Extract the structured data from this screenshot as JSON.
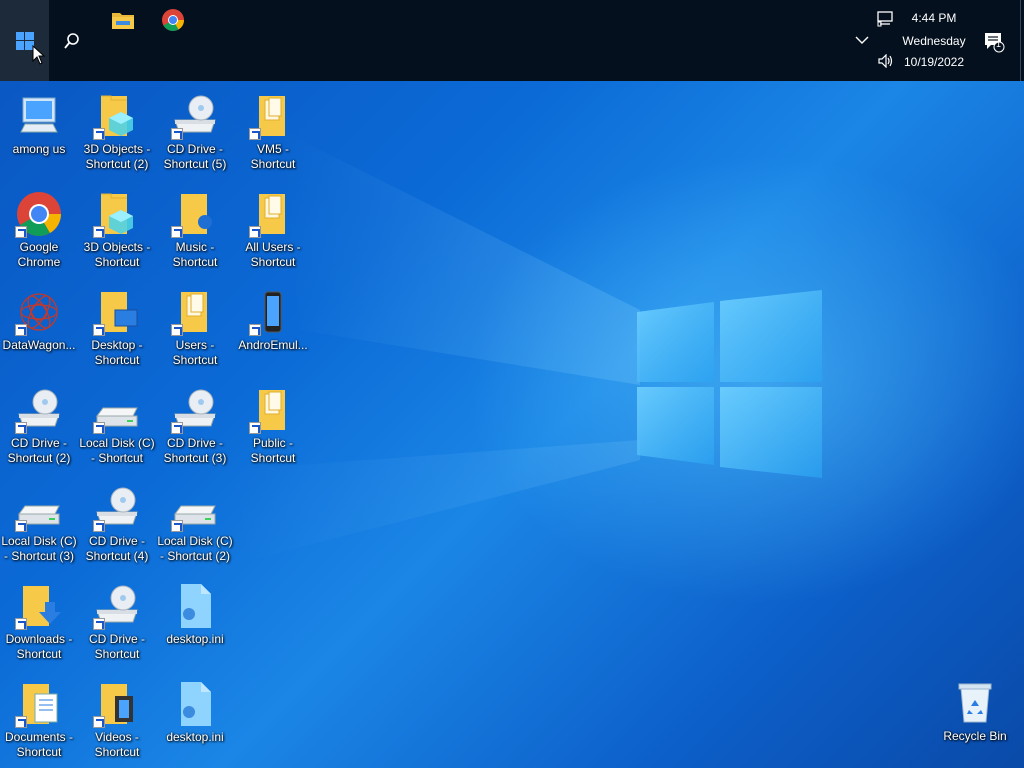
{
  "taskbar": {
    "pinned": [
      {
        "name": "file-explorer-icon"
      },
      {
        "name": "chrome-icon"
      }
    ],
    "clock": {
      "time": "4:44 PM",
      "day": "Wednesday",
      "date": "10/19/2022"
    },
    "notification_count": "1"
  },
  "desktop_icons": [
    {
      "label": "among us",
      "type": "computer",
      "shortcut": false
    },
    {
      "label": "3D Objects - Shortcut (2)",
      "type": "folder-3d",
      "shortcut": true
    },
    {
      "label": "CD Drive - Shortcut (5)",
      "type": "cd-drive",
      "shortcut": true
    },
    {
      "label": "VM5 - Shortcut",
      "type": "folder-docs",
      "shortcut": true
    },
    {
      "label": "Google Chrome",
      "type": "chrome",
      "shortcut": true
    },
    {
      "label": "3D Objects - Shortcut",
      "type": "folder-3d",
      "shortcut": true
    },
    {
      "label": "Music - Shortcut",
      "type": "folder-music",
      "shortcut": true
    },
    {
      "label": "All Users - Shortcut",
      "type": "folder-docs",
      "shortcut": true
    },
    {
      "label": "DataWagon...",
      "type": "datawagon",
      "shortcut": true
    },
    {
      "label": "Desktop - Shortcut",
      "type": "folder-desktop",
      "shortcut": true
    },
    {
      "label": "Users - Shortcut",
      "type": "folder-docs",
      "shortcut": true
    },
    {
      "label": "AndroEmul...",
      "type": "phone",
      "shortcut": true
    },
    {
      "label": "CD Drive - Shortcut (2)",
      "type": "cd-drive",
      "shortcut": true
    },
    {
      "label": "Local Disk (C) - Shortcut",
      "type": "local-disk",
      "shortcut": true
    },
    {
      "label": "CD Drive - Shortcut (3)",
      "type": "cd-drive",
      "shortcut": true
    },
    {
      "label": "Public - Shortcut",
      "type": "folder-docs",
      "shortcut": true
    },
    {
      "label": "Local Disk (C) - Shortcut (3)",
      "type": "local-disk",
      "shortcut": true
    },
    {
      "label": "CD Drive - Shortcut (4)",
      "type": "cd-drive",
      "shortcut": true
    },
    {
      "label": "Local Disk (C) - Shortcut (2)",
      "type": "local-disk",
      "shortcut": true
    },
    {
      "label": "Downloads - Shortcut",
      "type": "folder-downloads",
      "shortcut": true
    },
    {
      "label": "CD Drive - Shortcut",
      "type": "cd-drive",
      "shortcut": true
    },
    {
      "label": "desktop.ini",
      "type": "ini-file",
      "shortcut": false
    },
    {
      "label": "Documents - Shortcut",
      "type": "folder-documents",
      "shortcut": true
    },
    {
      "label": "Videos - Shortcut",
      "type": "folder-videos",
      "shortcut": true
    },
    {
      "label": "desktop.ini",
      "type": "ini-file",
      "shortcut": false
    }
  ],
  "recycle_bin": {
    "label": "Recycle Bin"
  },
  "colors": {
    "taskbar": "#05101e",
    "start_hover": "#1d2a39",
    "desktop_blue": "#0b6ad6",
    "folder_yellow": "#f7c948"
  }
}
